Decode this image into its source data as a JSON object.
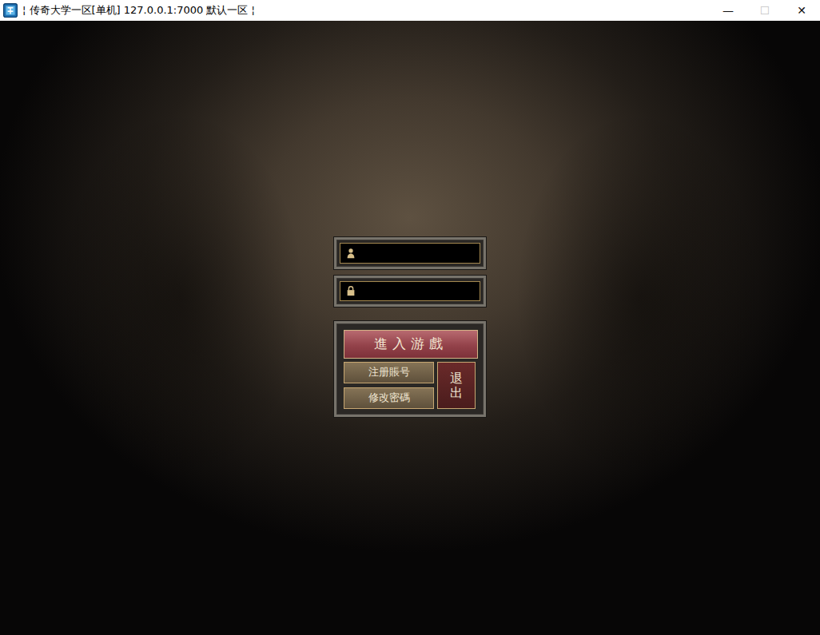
{
  "window": {
    "title": "¦ 传奇大学一区[单机] 127.0.0.1:7000  默认一区 ¦",
    "controls": [
      {
        "label": "—",
        "disabled": false
      },
      {
        "label": "☐",
        "disabled": true
      },
      {
        "label": "✕",
        "disabled": false
      }
    ]
  },
  "login": {
    "fields": [
      {
        "kind": "username",
        "focused": true
      },
      {
        "kind": "password",
        "focused": false
      }
    ],
    "buttons": {
      "enter": "進入游戲",
      "register": "注册賬号",
      "change_password": "修改密碼",
      "exit": "退出"
    }
  }
}
